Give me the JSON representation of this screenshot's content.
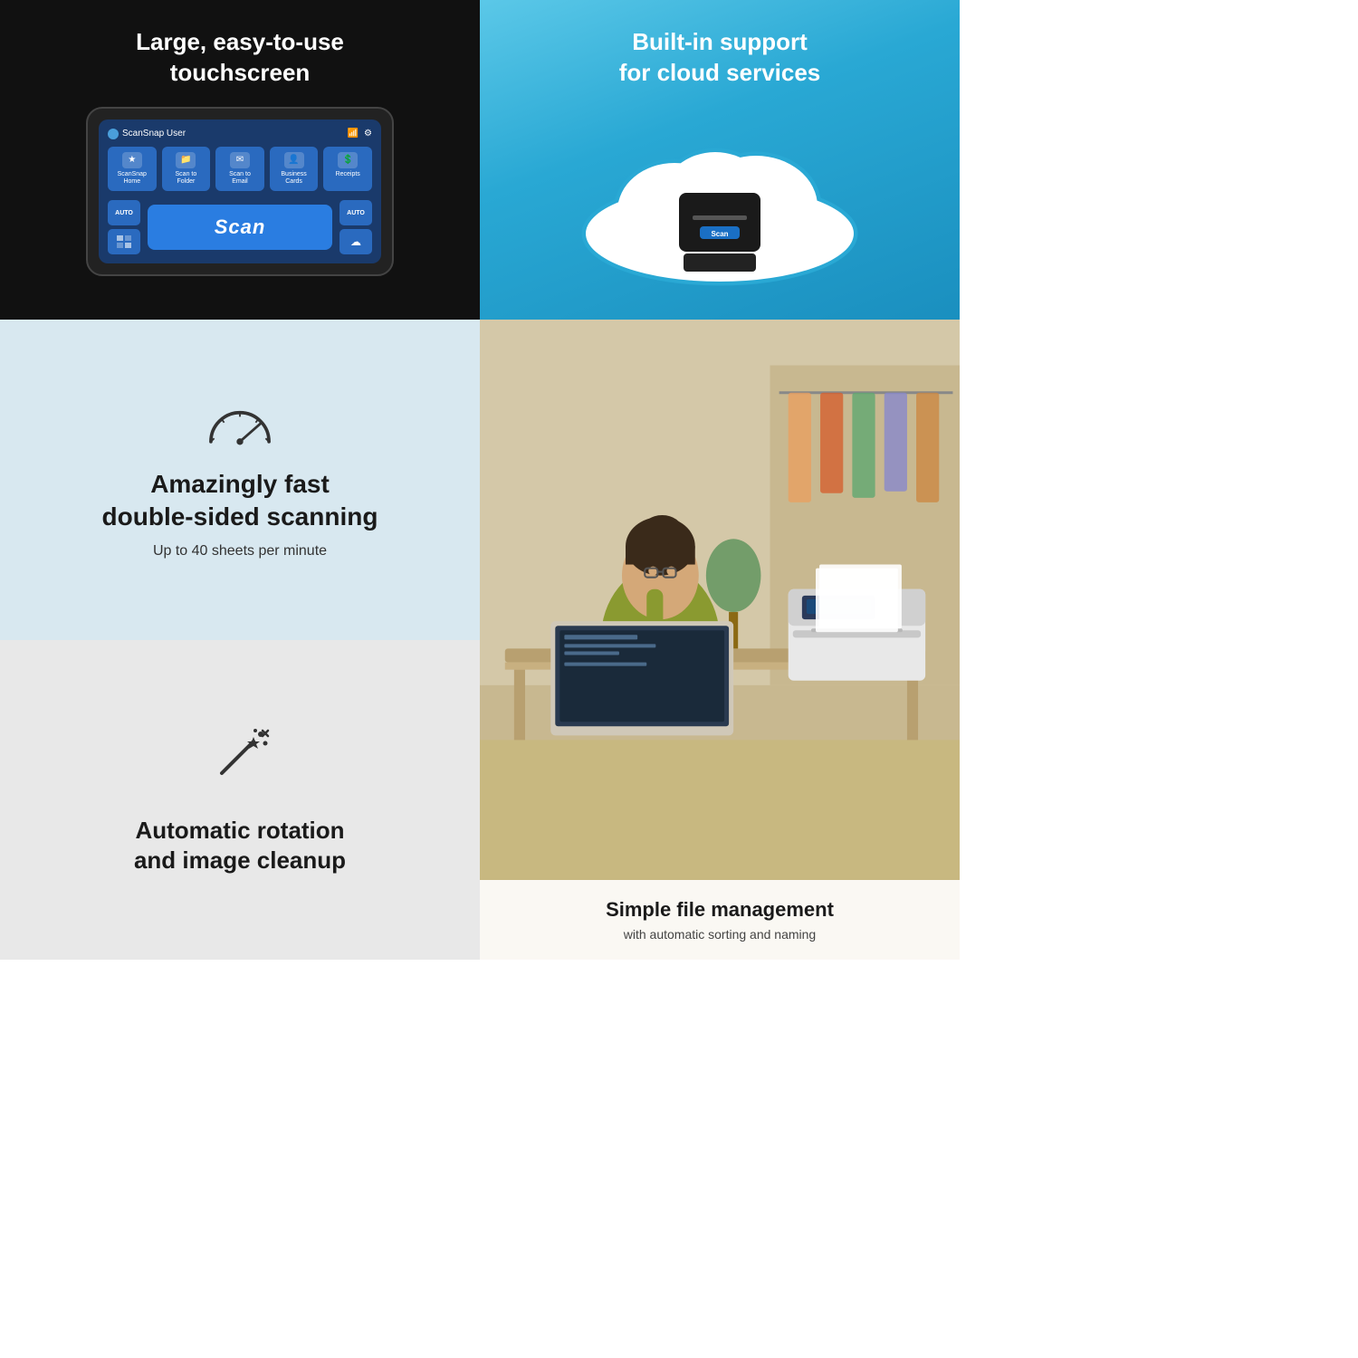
{
  "quadrants": {
    "touchscreen": {
      "heading_line1": "Large, easy-to-use",
      "heading_line2": "touchscreen",
      "screen": {
        "user_label": "ScanSnap User",
        "buttons": [
          {
            "label": "ScanSnap\nHome",
            "icon": "★"
          },
          {
            "label": "Scan to\nFolder",
            "icon": "📁"
          },
          {
            "label": "Scan to\nEmail",
            "icon": "✉"
          },
          {
            "label": "Business\nCards",
            "icon": "👤"
          },
          {
            "label": "Receipts",
            "icon": "💲"
          }
        ],
        "scan_btn_label": "Scan",
        "auto_label": "AUTO"
      }
    },
    "cloud": {
      "heading_line1": "Built-in support",
      "heading_line2": "for cloud services",
      "scan_btn": "Scan"
    },
    "fast_scanning": {
      "heading_line1": "Amazingly fast",
      "heading_line2": "double-sided scanning",
      "subtext": "Up to 40 sheets per minute"
    },
    "rotation": {
      "heading_line1": "Automatic rotation",
      "heading_line2": "and image cleanup"
    },
    "file_management": {
      "heading": "Simple file management",
      "subtext": "with automatic sorting and naming"
    }
  }
}
